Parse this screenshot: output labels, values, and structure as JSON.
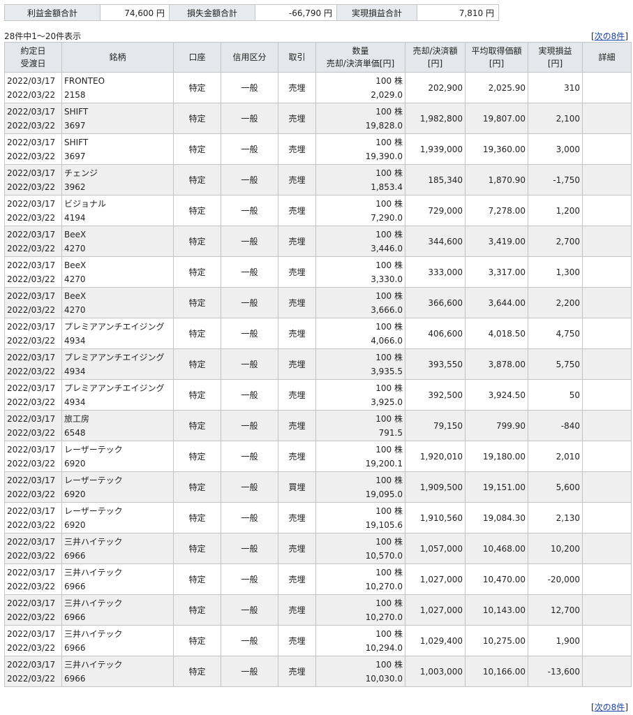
{
  "summary": {
    "profit_label": "利益金額合計",
    "profit_value": "74,600 円",
    "loss_label": "損失金額合計",
    "loss_value": "-66,790 円",
    "realized_label": "実現損益合計",
    "realized_value": "7,810 円"
  },
  "info": "28件中1～20件表示",
  "pager": {
    "open": "[",
    "link": "次の8件",
    "close": "]"
  },
  "headers": {
    "date1": "約定日",
    "date2": "受渡日",
    "name": "銘柄",
    "account": "口座",
    "credit": "信用区分",
    "trade": "取引",
    "qty1": "数量",
    "qty2": "売却/決済単価[円]",
    "amount1": "売却/決済額",
    "amount2": "[円]",
    "avg1": "平均取得価額",
    "avg2": "[円]",
    "pl1": "実現損益",
    "pl2": "[円]",
    "detail": "詳細"
  },
  "rows": [
    {
      "trade_date": "2022/03/17",
      "settle_date": "2022/03/22",
      "name": "FRONTEO",
      "code": "2158",
      "account": "特定",
      "credit": "一般",
      "trade": "売埋",
      "qty": "100 株",
      "price": "2,029.0",
      "amount": "202,900",
      "avg": "2,025.90",
      "pl": "310"
    },
    {
      "trade_date": "2022/03/17",
      "settle_date": "2022/03/22",
      "name": "SHIFT",
      "code": "3697",
      "account": "特定",
      "credit": "一般",
      "trade": "売埋",
      "qty": "100 株",
      "price": "19,828.0",
      "amount": "1,982,800",
      "avg": "19,807.00",
      "pl": "2,100"
    },
    {
      "trade_date": "2022/03/17",
      "settle_date": "2022/03/22",
      "name": "SHIFT",
      "code": "3697",
      "account": "特定",
      "credit": "一般",
      "trade": "売埋",
      "qty": "100 株",
      "price": "19,390.0",
      "amount": "1,939,000",
      "avg": "19,360.00",
      "pl": "3,000"
    },
    {
      "trade_date": "2022/03/17",
      "settle_date": "2022/03/22",
      "name": "チェンジ",
      "code": "3962",
      "account": "特定",
      "credit": "一般",
      "trade": "売埋",
      "qty": "100 株",
      "price": "1,853.4",
      "amount": "185,340",
      "avg": "1,870.90",
      "pl": "-1,750"
    },
    {
      "trade_date": "2022/03/17",
      "settle_date": "2022/03/22",
      "name": "ビジョナル",
      "code": "4194",
      "account": "特定",
      "credit": "一般",
      "trade": "売埋",
      "qty": "100 株",
      "price": "7,290.0",
      "amount": "729,000",
      "avg": "7,278.00",
      "pl": "1,200"
    },
    {
      "trade_date": "2022/03/17",
      "settle_date": "2022/03/22",
      "name": "BeeX",
      "code": "4270",
      "account": "特定",
      "credit": "一般",
      "trade": "売埋",
      "qty": "100 株",
      "price": "3,446.0",
      "amount": "344,600",
      "avg": "3,419.00",
      "pl": "2,700"
    },
    {
      "trade_date": "2022/03/17",
      "settle_date": "2022/03/22",
      "name": "BeeX",
      "code": "4270",
      "account": "特定",
      "credit": "一般",
      "trade": "売埋",
      "qty": "100 株",
      "price": "3,330.0",
      "amount": "333,000",
      "avg": "3,317.00",
      "pl": "1,300"
    },
    {
      "trade_date": "2022/03/17",
      "settle_date": "2022/03/22",
      "name": "BeeX",
      "code": "4270",
      "account": "特定",
      "credit": "一般",
      "trade": "売埋",
      "qty": "100 株",
      "price": "3,666.0",
      "amount": "366,600",
      "avg": "3,644.00",
      "pl": "2,200"
    },
    {
      "trade_date": "2022/03/17",
      "settle_date": "2022/03/22",
      "name": "プレミアアンチエイジング",
      "code": "4934",
      "account": "特定",
      "credit": "一般",
      "trade": "売埋",
      "qty": "100 株",
      "price": "4,066.0",
      "amount": "406,600",
      "avg": "4,018.50",
      "pl": "4,750"
    },
    {
      "trade_date": "2022/03/17",
      "settle_date": "2022/03/22",
      "name": "プレミアアンチエイジング",
      "code": "4934",
      "account": "特定",
      "credit": "一般",
      "trade": "売埋",
      "qty": "100 株",
      "price": "3,935.5",
      "amount": "393,550",
      "avg": "3,878.00",
      "pl": "5,750"
    },
    {
      "trade_date": "2022/03/17",
      "settle_date": "2022/03/22",
      "name": "プレミアアンチエイジング",
      "code": "4934",
      "account": "特定",
      "credit": "一般",
      "trade": "売埋",
      "qty": "100 株",
      "price": "3,925.0",
      "amount": "392,500",
      "avg": "3,924.50",
      "pl": "50"
    },
    {
      "trade_date": "2022/03/17",
      "settle_date": "2022/03/22",
      "name": "旅工房",
      "code": "6548",
      "account": "特定",
      "credit": "一般",
      "trade": "売埋",
      "qty": "100 株",
      "price": "791.5",
      "amount": "79,150",
      "avg": "799.90",
      "pl": "-840"
    },
    {
      "trade_date": "2022/03/17",
      "settle_date": "2022/03/22",
      "name": "レーザーテック",
      "code": "6920",
      "account": "特定",
      "credit": "一般",
      "trade": "売埋",
      "qty": "100 株",
      "price": "19,200.1",
      "amount": "1,920,010",
      "avg": "19,180.00",
      "pl": "2,010"
    },
    {
      "trade_date": "2022/03/17",
      "settle_date": "2022/03/22",
      "name": "レーザーテック",
      "code": "6920",
      "account": "特定",
      "credit": "一般",
      "trade": "買埋",
      "qty": "100 株",
      "price": "19,095.0",
      "amount": "1,909,500",
      "avg": "19,151.00",
      "pl": "5,600"
    },
    {
      "trade_date": "2022/03/17",
      "settle_date": "2022/03/22",
      "name": "レーザーテック",
      "code": "6920",
      "account": "特定",
      "credit": "一般",
      "trade": "売埋",
      "qty": "100 株",
      "price": "19,105.6",
      "amount": "1,910,560",
      "avg": "19,084.30",
      "pl": "2,130"
    },
    {
      "trade_date": "2022/03/17",
      "settle_date": "2022/03/22",
      "name": "三井ハイテック",
      "code": "6966",
      "account": "特定",
      "credit": "一般",
      "trade": "売埋",
      "qty": "100 株",
      "price": "10,570.0",
      "amount": "1,057,000",
      "avg": "10,468.00",
      "pl": "10,200"
    },
    {
      "trade_date": "2022/03/17",
      "settle_date": "2022/03/22",
      "name": "三井ハイテック",
      "code": "6966",
      "account": "特定",
      "credit": "一般",
      "trade": "売埋",
      "qty": "100 株",
      "price": "10,270.0",
      "amount": "1,027,000",
      "avg": "10,470.00",
      "pl": "-20,000"
    },
    {
      "trade_date": "2022/03/17",
      "settle_date": "2022/03/22",
      "name": "三井ハイテック",
      "code": "6966",
      "account": "特定",
      "credit": "一般",
      "trade": "売埋",
      "qty": "100 株",
      "price": "10,270.0",
      "amount": "1,027,000",
      "avg": "10,143.00",
      "pl": "12,700"
    },
    {
      "trade_date": "2022/03/17",
      "settle_date": "2022/03/22",
      "name": "三井ハイテック",
      "code": "6966",
      "account": "特定",
      "credit": "一般",
      "trade": "売埋",
      "qty": "100 株",
      "price": "10,294.0",
      "amount": "1,029,400",
      "avg": "10,275.00",
      "pl": "1,900"
    },
    {
      "trade_date": "2022/03/17",
      "settle_date": "2022/03/22",
      "name": "三井ハイテック",
      "code": "6966",
      "account": "特定",
      "credit": "一般",
      "trade": "売埋",
      "qty": "100 株",
      "price": "10,030.0",
      "amount": "1,003,000",
      "avg": "10,166.00",
      "pl": "-13,600"
    }
  ]
}
